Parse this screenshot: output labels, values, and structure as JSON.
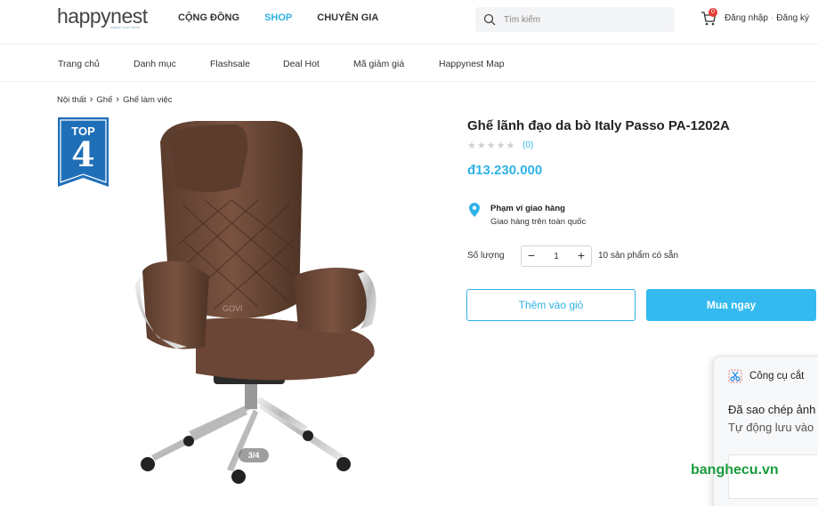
{
  "header": {
    "logo": "happynest",
    "logo_sub": "Inspire Your Home",
    "nav": [
      "CỘNG ĐỒNG",
      "SHOP",
      "CHUYÊN GIA"
    ],
    "search_placeholder": "Tìm kiếm",
    "cart_count": "0",
    "login": "Đăng nhập",
    "register": "Đăng ký"
  },
  "subnav": [
    "Trang chủ",
    "Danh mục",
    "Flashsale",
    "Deal Hot",
    "Mã giảm giá",
    "Happynest Map"
  ],
  "breadcrumb": [
    "Nội thất",
    "Ghế",
    "Ghế làm việc"
  ],
  "badge": {
    "top": "TOP",
    "number": "4"
  },
  "gallery": {
    "pager": "3/4",
    "image_watermark": "GOVI"
  },
  "product": {
    "title": "Ghế lãnh đạo da bò Italy Passo PA-1202A",
    "rating": 0,
    "reviews": "(0)",
    "price": "đ13.230.000",
    "shipping_title": "Phạm vi giao hàng",
    "shipping_desc": "Giao hàng trên toàn quốc",
    "qty_label": "Số lượng",
    "qty_value": "1",
    "stock": "10 sản phẩm có sẵn",
    "add_to_cart": "Thêm vào giỏ",
    "buy_now": "Mua ngay"
  },
  "toast": {
    "app": "Công cụ cắt",
    "line1": "Đã sao chép ảnh",
    "line2": "Tự động lưu vào"
  },
  "watermark": "banghecu.vn",
  "colors": {
    "accent": "#2fb3e6",
    "button": "#34baee",
    "badge": "#1f6fb8",
    "watermark": "#1a9c3b"
  }
}
